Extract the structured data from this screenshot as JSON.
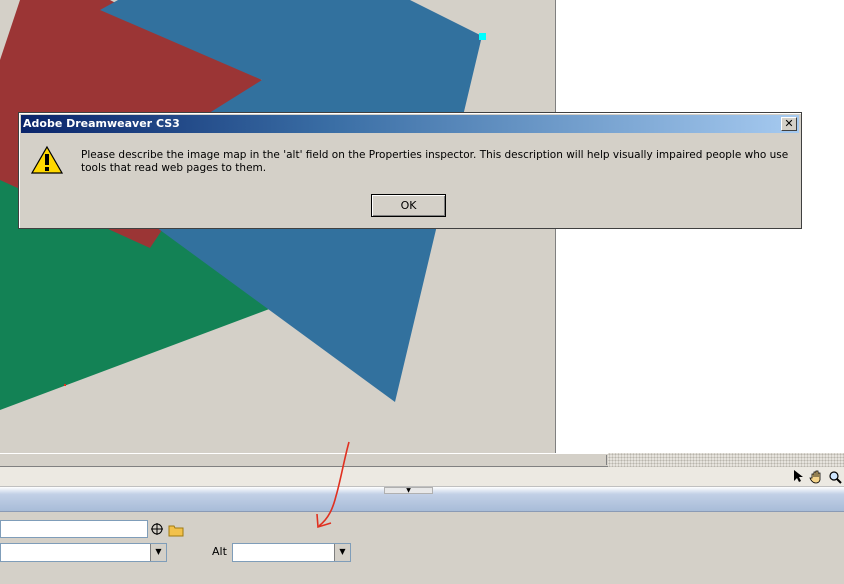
{
  "dialog": {
    "title": "Adobe Dreamweaver CS3",
    "close_label": "✕",
    "message": "Please describe the image map in the 'alt' field on the Properties inspector. This description will help visually impaired people who use tools that read web pages to them.",
    "ok_label": "OK",
    "icon": "warning-icon"
  },
  "properties": {
    "link_value": "",
    "target_value": "",
    "alt_label": "Alt",
    "alt_value": ""
  },
  "tools": {
    "pointer_icon": "pointer-tool-icon",
    "hand_icon": "hand-tool-icon",
    "zoom_icon": "zoom-tool-icon"
  },
  "colors": {
    "shape_red": "#9b3535",
    "shape_green": "#138255",
    "shape_blue": "#32719e",
    "hotspot_handle": "#00ffff",
    "annotation": "#e03020"
  }
}
